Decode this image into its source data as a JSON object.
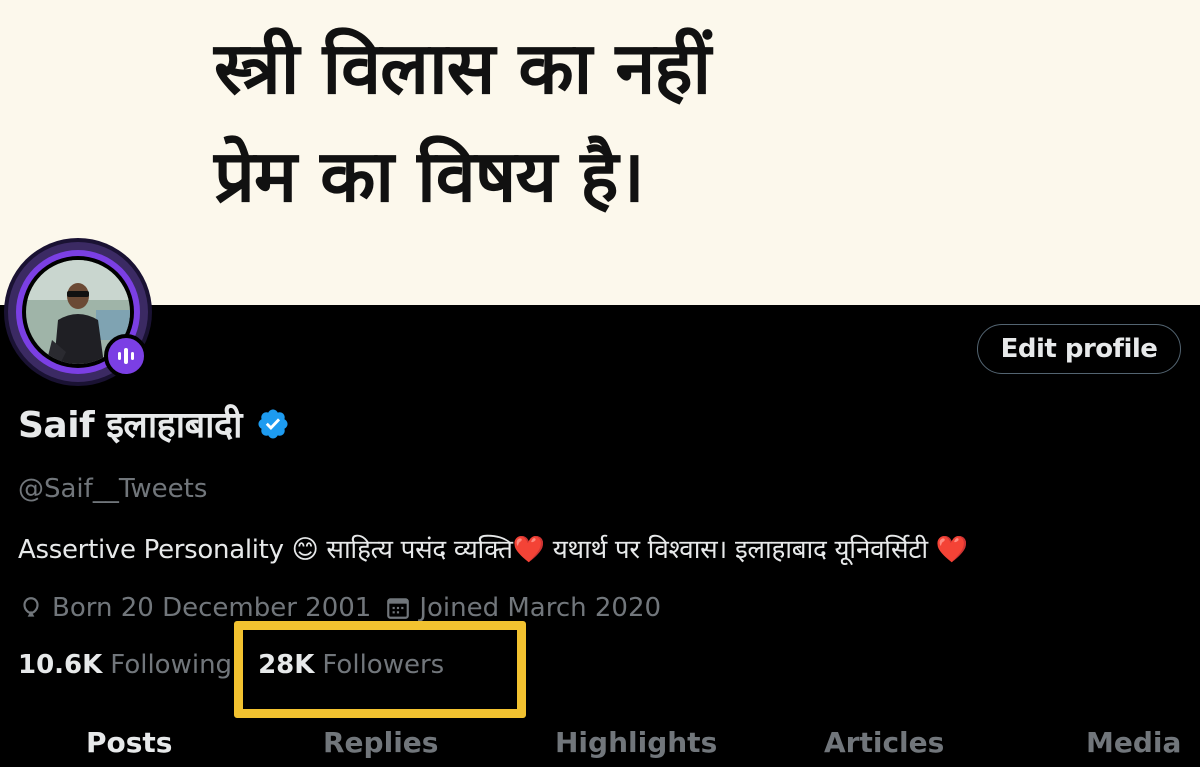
{
  "banner": {
    "line1": "स्त्री विलास का नहीं",
    "line2": "प्रेम का विषय है।"
  },
  "profile": {
    "edit_button": "Edit profile",
    "display_name": "Saif इलाहाबादी",
    "handle": "@Saif__Tweets",
    "bio": "Assertive Personality 😊  साहित्य पसंद व्यक्ति❤️  यथार्थ पर विश्वास। इलाहाबाद यूनिवर्सिटी ❤️",
    "born": "Born 20 December 2001",
    "joined": "Joined March 2020",
    "following_count": "10.6K",
    "following_label": "Following",
    "followers_count": "28K",
    "followers_label": "Followers"
  },
  "tabs": [
    {
      "label": "Posts",
      "active": true
    },
    {
      "label": "Replies",
      "active": false
    },
    {
      "label": "Highlights",
      "active": false
    },
    {
      "label": "Articles",
      "active": false
    },
    {
      "label": "Media",
      "active": false
    }
  ],
  "colors": {
    "background": "#000000",
    "banner": "#fcf8ec",
    "verified": "#1d9bf0",
    "avatar_ring": "#7b3fe4",
    "highlight": "#f2c230",
    "muted_text": "#71767b"
  },
  "icons": {
    "badge": "audio-space-icon",
    "verified": "verified-badge-icon",
    "born": "balloon-icon",
    "joined": "calendar-icon"
  }
}
